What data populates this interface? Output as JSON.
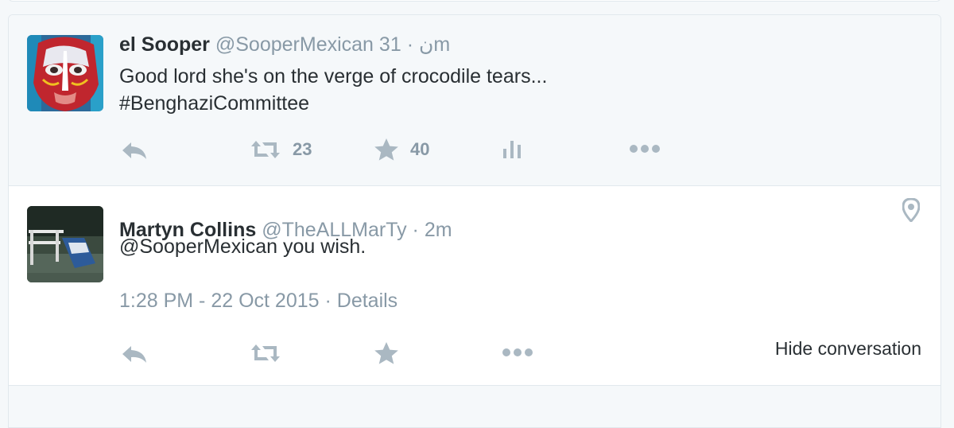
{
  "conversation": {
    "ancestor": {
      "fullname": "el Sooper",
      "username": "@SooperMexican",
      "rtl_mark": "ن",
      "separator": "·",
      "time": "31m",
      "text_lines": [
        "Good lord she's on the verge of crocodile tears...",
        "#BenghaziCommittee"
      ],
      "actions": {
        "reply_icon": "reply-icon",
        "retweet_icon": "retweet-icon",
        "retweet_count": "23",
        "favorite_icon": "star-icon",
        "favorite_count": "40",
        "analytics_icon": "bar-chart-icon",
        "more_icon": "more-dots-icon"
      }
    },
    "focused": {
      "fullname": "Martyn Collins",
      "username": "@TheALLMarTy",
      "separator": "·",
      "time": "2m",
      "text": "@SooperMexican you wish.",
      "timestamp": "1:28 PM - 22 Oct 2015",
      "meta_separator": "·",
      "details_link": "Details",
      "geo_icon": "location-pin-icon",
      "actions": {
        "reply_icon": "reply-icon",
        "retweet_icon": "retweet-icon",
        "favorite_icon": "star-icon",
        "more_icon": "more-dots-icon"
      },
      "hide_conversation": "Hide conversation"
    }
  },
  "colors": {
    "text_primary": "#292f33",
    "text_secondary": "#8899a6",
    "icon": "#aab8c2",
    "border": "#e1e8ed",
    "ancestor_bg": "#f5f8fa",
    "focused_bg": "#ffffff"
  }
}
